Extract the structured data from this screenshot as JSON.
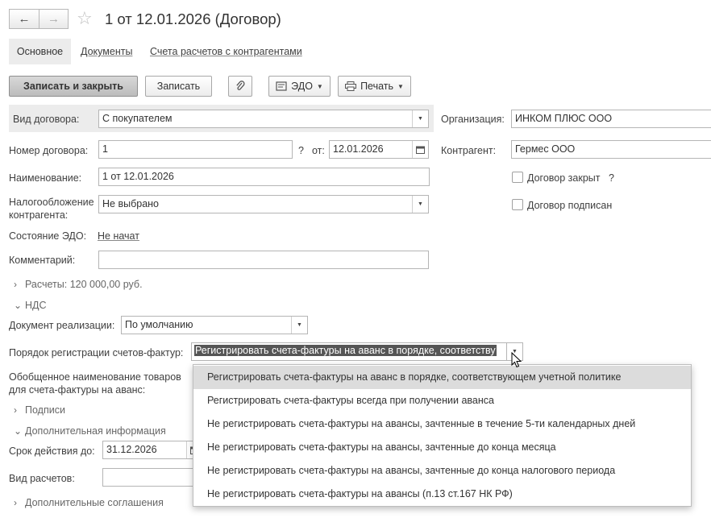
{
  "nav": {
    "back_icon": "arrow-left-icon",
    "forward_icon": "arrow-right-icon",
    "star_icon": "star-outline-icon"
  },
  "title": "1 от 12.01.2026 (Договор)",
  "tabs": [
    {
      "label": "Основное"
    },
    {
      "label": "Документы"
    },
    {
      "label": "Счета расчетов с контрагентами"
    }
  ],
  "toolbar": {
    "save_close": "Записать и закрыть",
    "save": "Записать",
    "edo": "ЭДО",
    "print": "Печать"
  },
  "form": {
    "contract_type_label": "Вид договора:",
    "contract_type_value": "С покупателем",
    "org_label": "Организация:",
    "org_value": "ИНКОМ ПЛЮС ООО",
    "number_label": "Номер договора:",
    "number_value": "1",
    "question": "?",
    "from_label": "от:",
    "date_value": "12.01.2026",
    "counterparty_label": "Контрагент:",
    "counterparty_value": "Гермес ООО",
    "name_label": "Наименование:",
    "name_value": "1 от 12.01.2026",
    "closed_label": "Договор закрыт",
    "closed_question": "?",
    "tax_label_1": "Налогообложение",
    "tax_label_2": "контрагента:",
    "tax_value": "Не выбрано",
    "signed_label": "Договор подписан",
    "edo_state_label": "Состояние ЭДО:",
    "edo_state_value": "Не начат",
    "comment_label": "Комментарий:",
    "comment_value": ""
  },
  "groups": {
    "payments": "Расчеты: 120 000,00 руб.",
    "vat": "НДС",
    "signatures": "Подписи",
    "extra_info": "Дополнительная информация",
    "extra_agreements": "Дополнительные соглашения"
  },
  "vat": {
    "sale_doc_label": "Документ реализации:",
    "sale_doc_value": "По умолчанию",
    "invoice_order_label": "Порядок регистрации счетов-фактур:",
    "invoice_order_value": "Регистрировать счета-фактуры на аванс в порядке, соответству",
    "goods_name_label_1": "Обобщенное наименование товаров",
    "goods_name_label_2": "для счета-фактуры на аванс:"
  },
  "extra": {
    "valid_until_label": "Срок действия до:",
    "valid_until_value": "31.12.2026",
    "payment_type_label": "Вид расчетов:",
    "payment_type_value": ""
  },
  "dropdown_options": [
    "Регистрировать счета-фактуры на аванс в порядке, соответствующем учетной политике",
    "Регистрировать счета-фактуры всегда при получении аванса",
    "Не регистрировать счета-фактуры на авансы, зачтенные в течение 5-ти календарных дней",
    "Не регистрировать счета-фактуры на авансы, зачтенные до конца месяца",
    "Не регистрировать счета-фактуры на авансы, зачтенные до конца налогового периода",
    "Не регистрировать счета-фактуры на авансы (п.13 ст.167 НК РФ)"
  ],
  "colors": {
    "selected_row": "#dcdcdc",
    "primary_button": "#c8c8c8",
    "selection_highlight": "#555555"
  }
}
